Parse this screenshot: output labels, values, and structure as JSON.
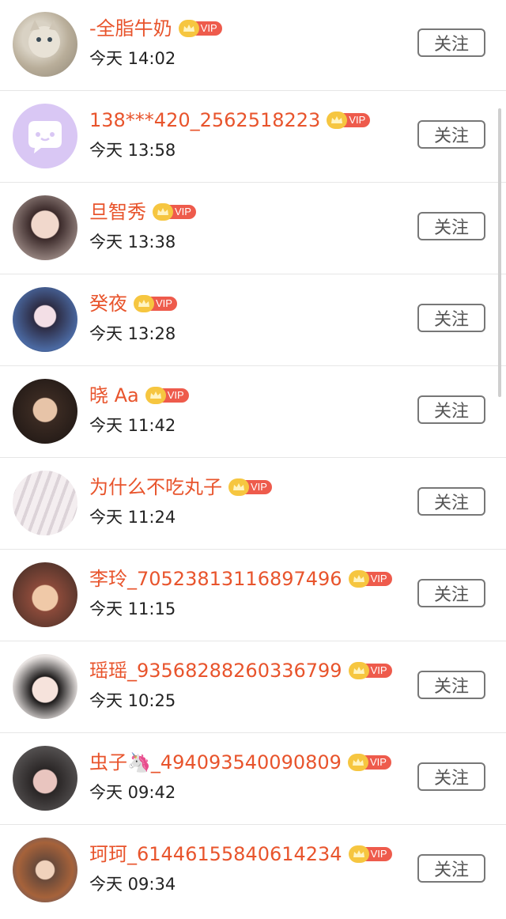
{
  "vip_label": "VIP",
  "follow_label": "关注",
  "colors": {
    "name": "#e8542c",
    "vip_tag": "#ee5b4c",
    "crown": "#f6c640"
  },
  "users": [
    {
      "name": "-全脂牛奶",
      "time": "今天 14:02",
      "avatar": "cat-avatar"
    },
    {
      "name": "138***420_2562518223",
      "time": "今天 13:58",
      "avatar": "default-chat-avatar"
    },
    {
      "name": "旦智秀",
      "time": "今天 13:38",
      "avatar": "person-avatar"
    },
    {
      "name": "癸夜",
      "time": "今天 13:28",
      "avatar": "anime-girl-avatar"
    },
    {
      "name": "晓 Aa",
      "time": "今天 11:42",
      "avatar": "person-avatar"
    },
    {
      "name": "为什么不吃丸子",
      "time": "今天 11:24",
      "avatar": "lace-photo-avatar"
    },
    {
      "name": "李玲_70523813116897496",
      "time": "今天 11:15",
      "avatar": "child-avatar"
    },
    {
      "name": "瑶瑶_93568288260336799",
      "time": "今天 10:25",
      "avatar": "person-avatar"
    },
    {
      "name": "虫子🦄_494093540090809",
      "time": "今天 09:42",
      "avatar": "person-avatar"
    },
    {
      "name": "珂珂_61446155840614234",
      "time": "今天 09:34",
      "avatar": "child-avatar"
    }
  ]
}
